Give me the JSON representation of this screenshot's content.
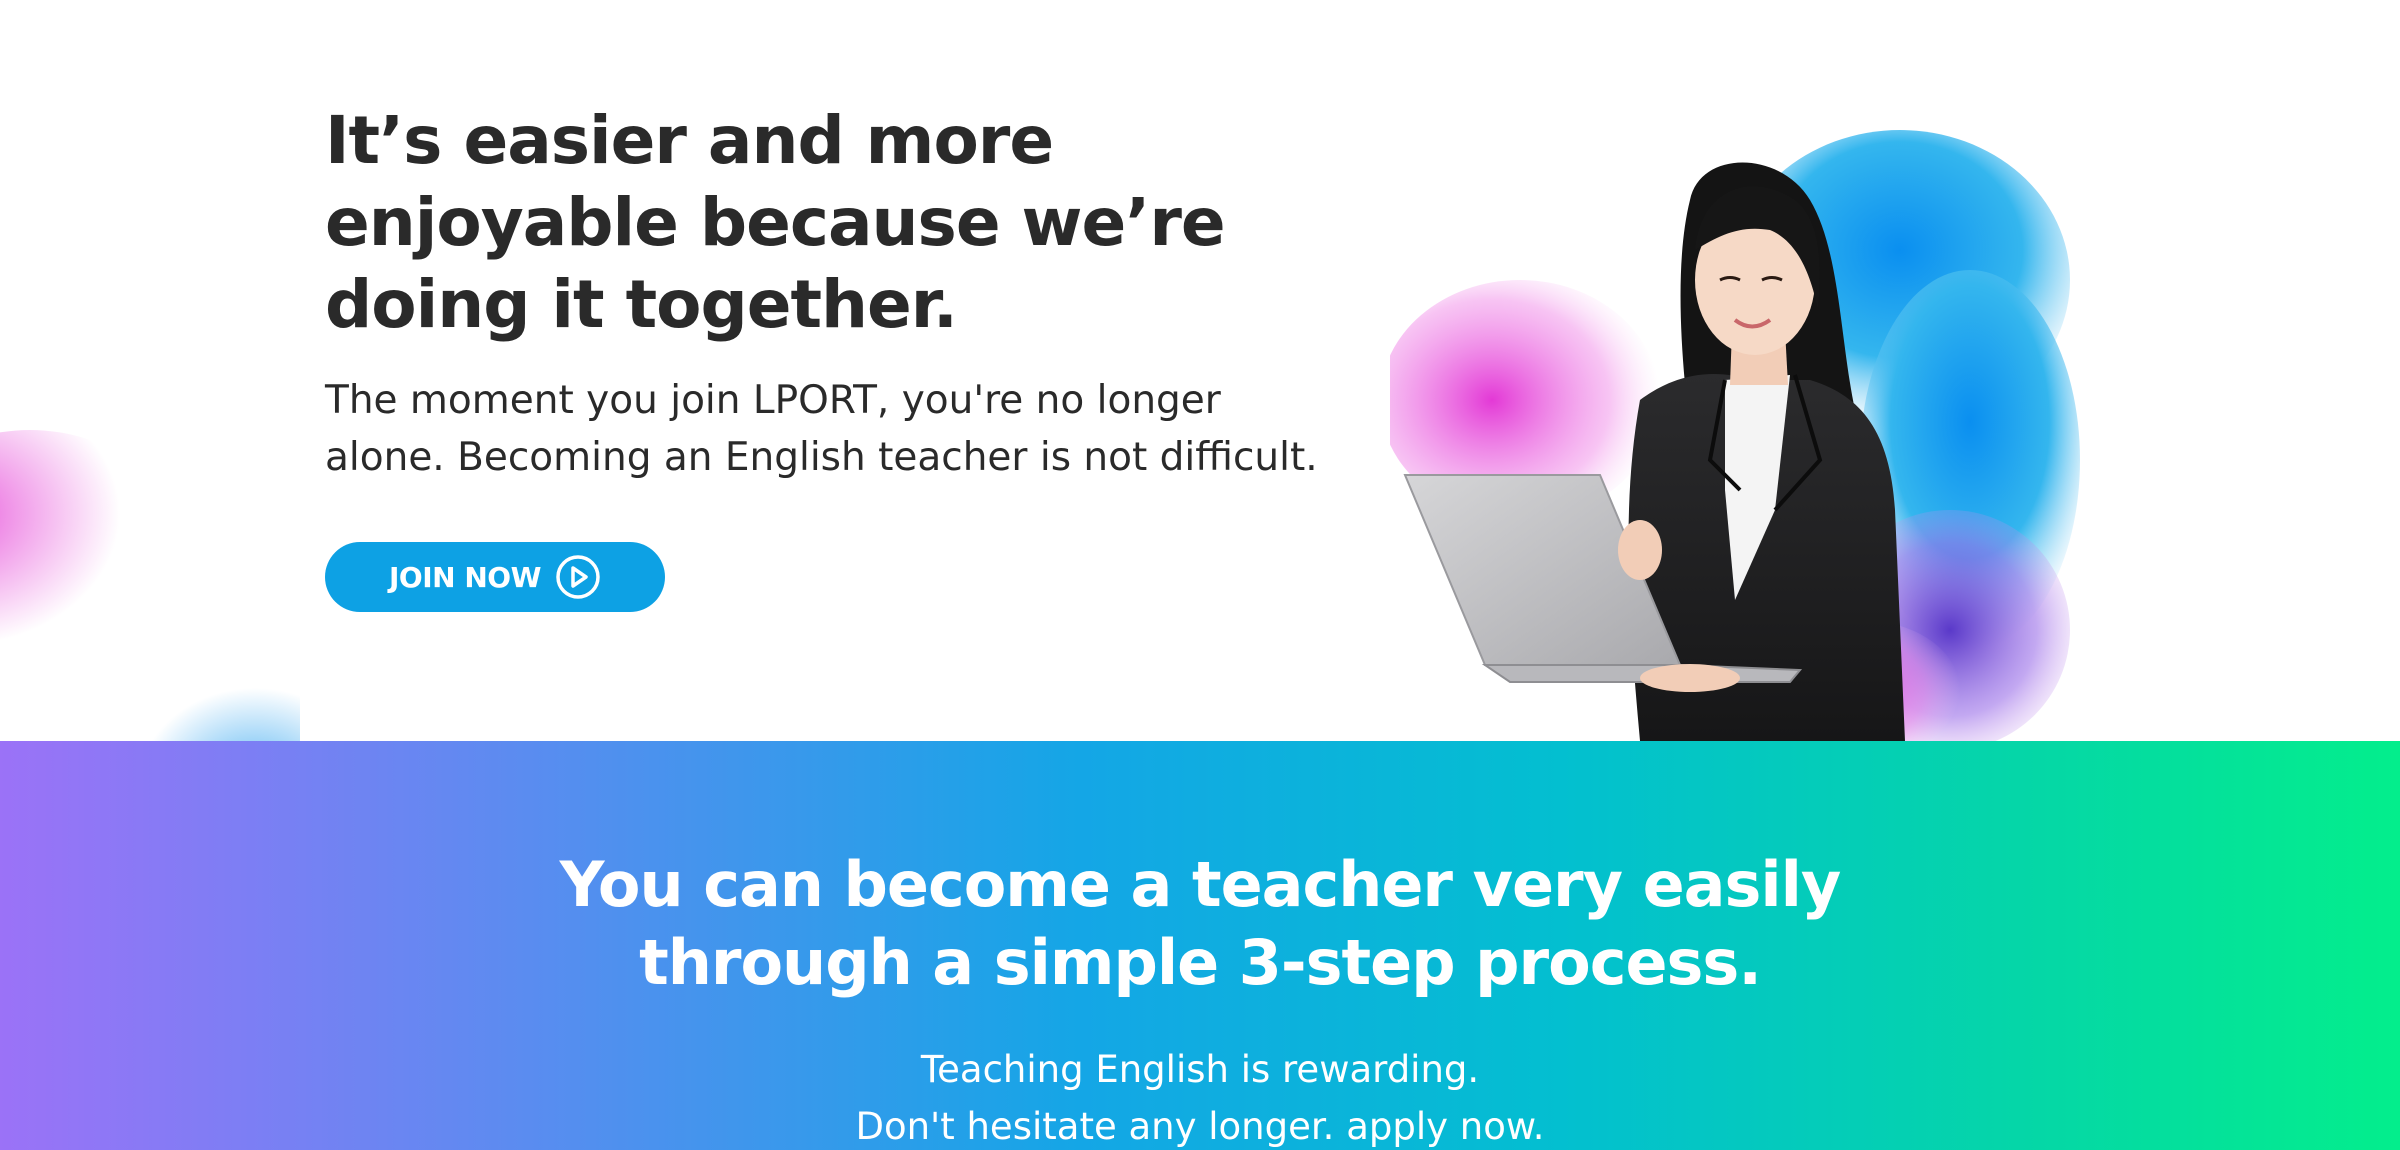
{
  "hero": {
    "title_line1": "It’s easier and more",
    "title_line2": "enjoyable because we’re",
    "title_line3": "doing it together.",
    "subtitle_line1": "The moment you join LPORT, you're no longer",
    "subtitle_line2": "alone. Becoming an English teacher is not difficult.",
    "cta_label": "JOIN NOW",
    "cta_icon": "play-circle-icon",
    "cta_color": "#0da1e4"
  },
  "process": {
    "title_line1": "You can become a teacher very easily",
    "title_line2": "through a simple 3-step process.",
    "sub_line1": "Teaching English is rewarding.",
    "sub_line2": "Don't hesitate any longer. apply now.",
    "gradient_start": "#9b72f7",
    "gradient_end": "#03ee8c"
  }
}
